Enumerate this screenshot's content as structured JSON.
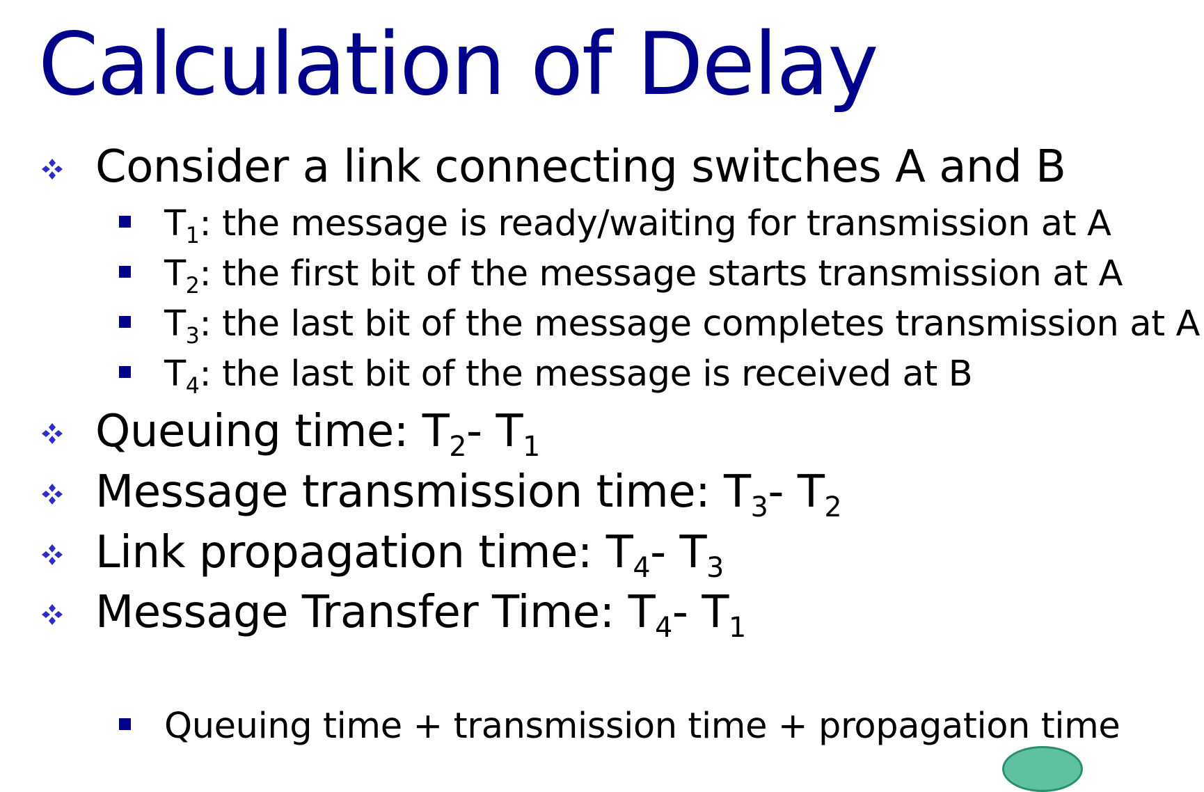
{
  "title": "Calculation of Delay",
  "colors": {
    "title": "#00008b",
    "text": "#000000",
    "bullet": "#2e2ec4"
  },
  "bullets": [
    {
      "level": 1,
      "pre": "Consider a link connecting switches A and B",
      "sub": "",
      "post": "",
      "sub2": ""
    },
    {
      "level": 2,
      "pre": "T",
      "sub": "1",
      "post": ": the message is ready/waiting for transmission at A",
      "sub2": ""
    },
    {
      "level": 2,
      "pre": "T",
      "sub": "2",
      "post": ": the first bit of the message starts  transmission at A",
      "sub2": ""
    },
    {
      "level": 2,
      "pre": "T",
      "sub": "3",
      "post": ": the last bit of the message completes transmission at A",
      "sub2": ""
    },
    {
      "level": 2,
      "pre": "T",
      "sub": "4",
      "post": ": the last bit of the message is received at B",
      "sub2": ""
    },
    {
      "level": 1,
      "pre": "Queuing time: T",
      "sub": "2",
      "post": "- T",
      "sub2": "1"
    },
    {
      "level": 1,
      "pre": "Message transmission time:  T",
      "sub": "3",
      "post": "- T",
      "sub2": "2"
    },
    {
      "level": 1,
      "pre": "Link propagation time: T",
      "sub": "4",
      "post": "- T",
      "sub2": "3"
    },
    {
      "level": 1,
      "pre": "Message Transfer Time: T",
      "sub": "4",
      "post": "- T",
      "sub2": "1"
    },
    {
      "level": 2,
      "pre": "Queuing time + transmission time + propagation time",
      "sub": "",
      "post": "",
      "sub2": ""
    }
  ]
}
